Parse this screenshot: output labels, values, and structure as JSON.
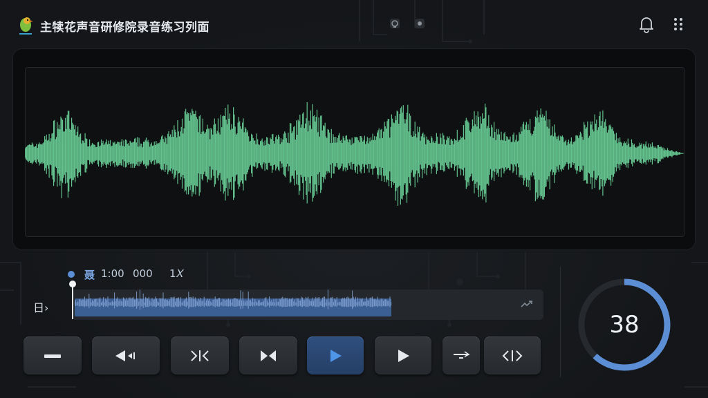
{
  "app": {
    "title": "主犊花声音研修院录音练习列面"
  },
  "colors": {
    "waveform": "#63c28d",
    "accent": "#5b8ed4",
    "progress_fill": "#3c5f93"
  },
  "icons": {
    "logo": "bird-logo-icon",
    "header_mini": [
      "headphones-icon",
      "record-icon"
    ],
    "notifications": "bell-icon",
    "menu": "more-vertical-icon"
  },
  "playback": {
    "label": "聂",
    "current": "1:00",
    "total": "000",
    "rate": "1𝑋"
  },
  "track": {
    "label": "日›",
    "progress": 0.715
  },
  "transport": [
    {
      "name": "minus-button",
      "icon": "minus-icon"
    },
    {
      "name": "rewind-button",
      "icon": "rewind-icon"
    },
    {
      "name": "split-button",
      "icon": "split-icon"
    },
    {
      "name": "join-button",
      "icon": "join-icon"
    },
    {
      "name": "play-button",
      "icon": "play-icon",
      "active": true
    },
    {
      "name": "next-button",
      "icon": "play-outline-icon"
    },
    {
      "name": "swap-button",
      "icon": "swap-icon"
    },
    {
      "name": "expand-button",
      "icon": "expand-icon"
    }
  ],
  "counter": {
    "value": "38",
    "progress": 0.62
  }
}
